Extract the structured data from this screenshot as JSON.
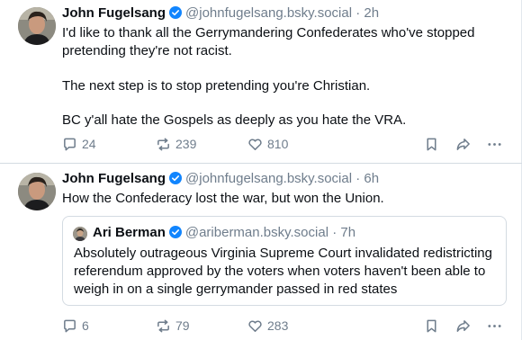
{
  "posts": [
    {
      "author_name": "John Fugelsang",
      "handle": "@johnfugelsang.bsky.social",
      "separator": "·",
      "time": "2h",
      "text_lines": [
        "I'd like to thank all the Gerrymandering Confederates who've stopped pretending they're not racist.",
        "The next step is to stop pretending you're Christian.",
        "BC y'all hate the Gospels as deeply as you hate the VRA."
      ],
      "replies": "24",
      "reposts": "239",
      "likes": "810"
    },
    {
      "author_name": "John Fugelsang",
      "handle": "@johnfugelsang.bsky.social",
      "separator": "·",
      "time": "6h",
      "text_lines": [
        "How the Confederacy lost the war, but won the Union."
      ],
      "quote": {
        "author_name": "Ari Berman",
        "handle": "@ariberman.bsky.social",
        "separator": "·",
        "time": "7h",
        "text": "Absolutely outrageous Virginia Supreme Court invalidated redistricting referendum approved by the voters when voters haven't been able to weigh in on a single gerrymander passed in red states"
      },
      "replies": "6",
      "reposts": "79",
      "likes": "283"
    }
  ],
  "colors": {
    "verified_badge": "#1185fe",
    "secondary_text": "#6f7d8c",
    "divider": "#d4dbe2"
  },
  "icons": [
    "reply-icon",
    "repost-icon",
    "like-icon",
    "bookmark-icon",
    "share-icon",
    "more-icon",
    "verified-icon"
  ]
}
